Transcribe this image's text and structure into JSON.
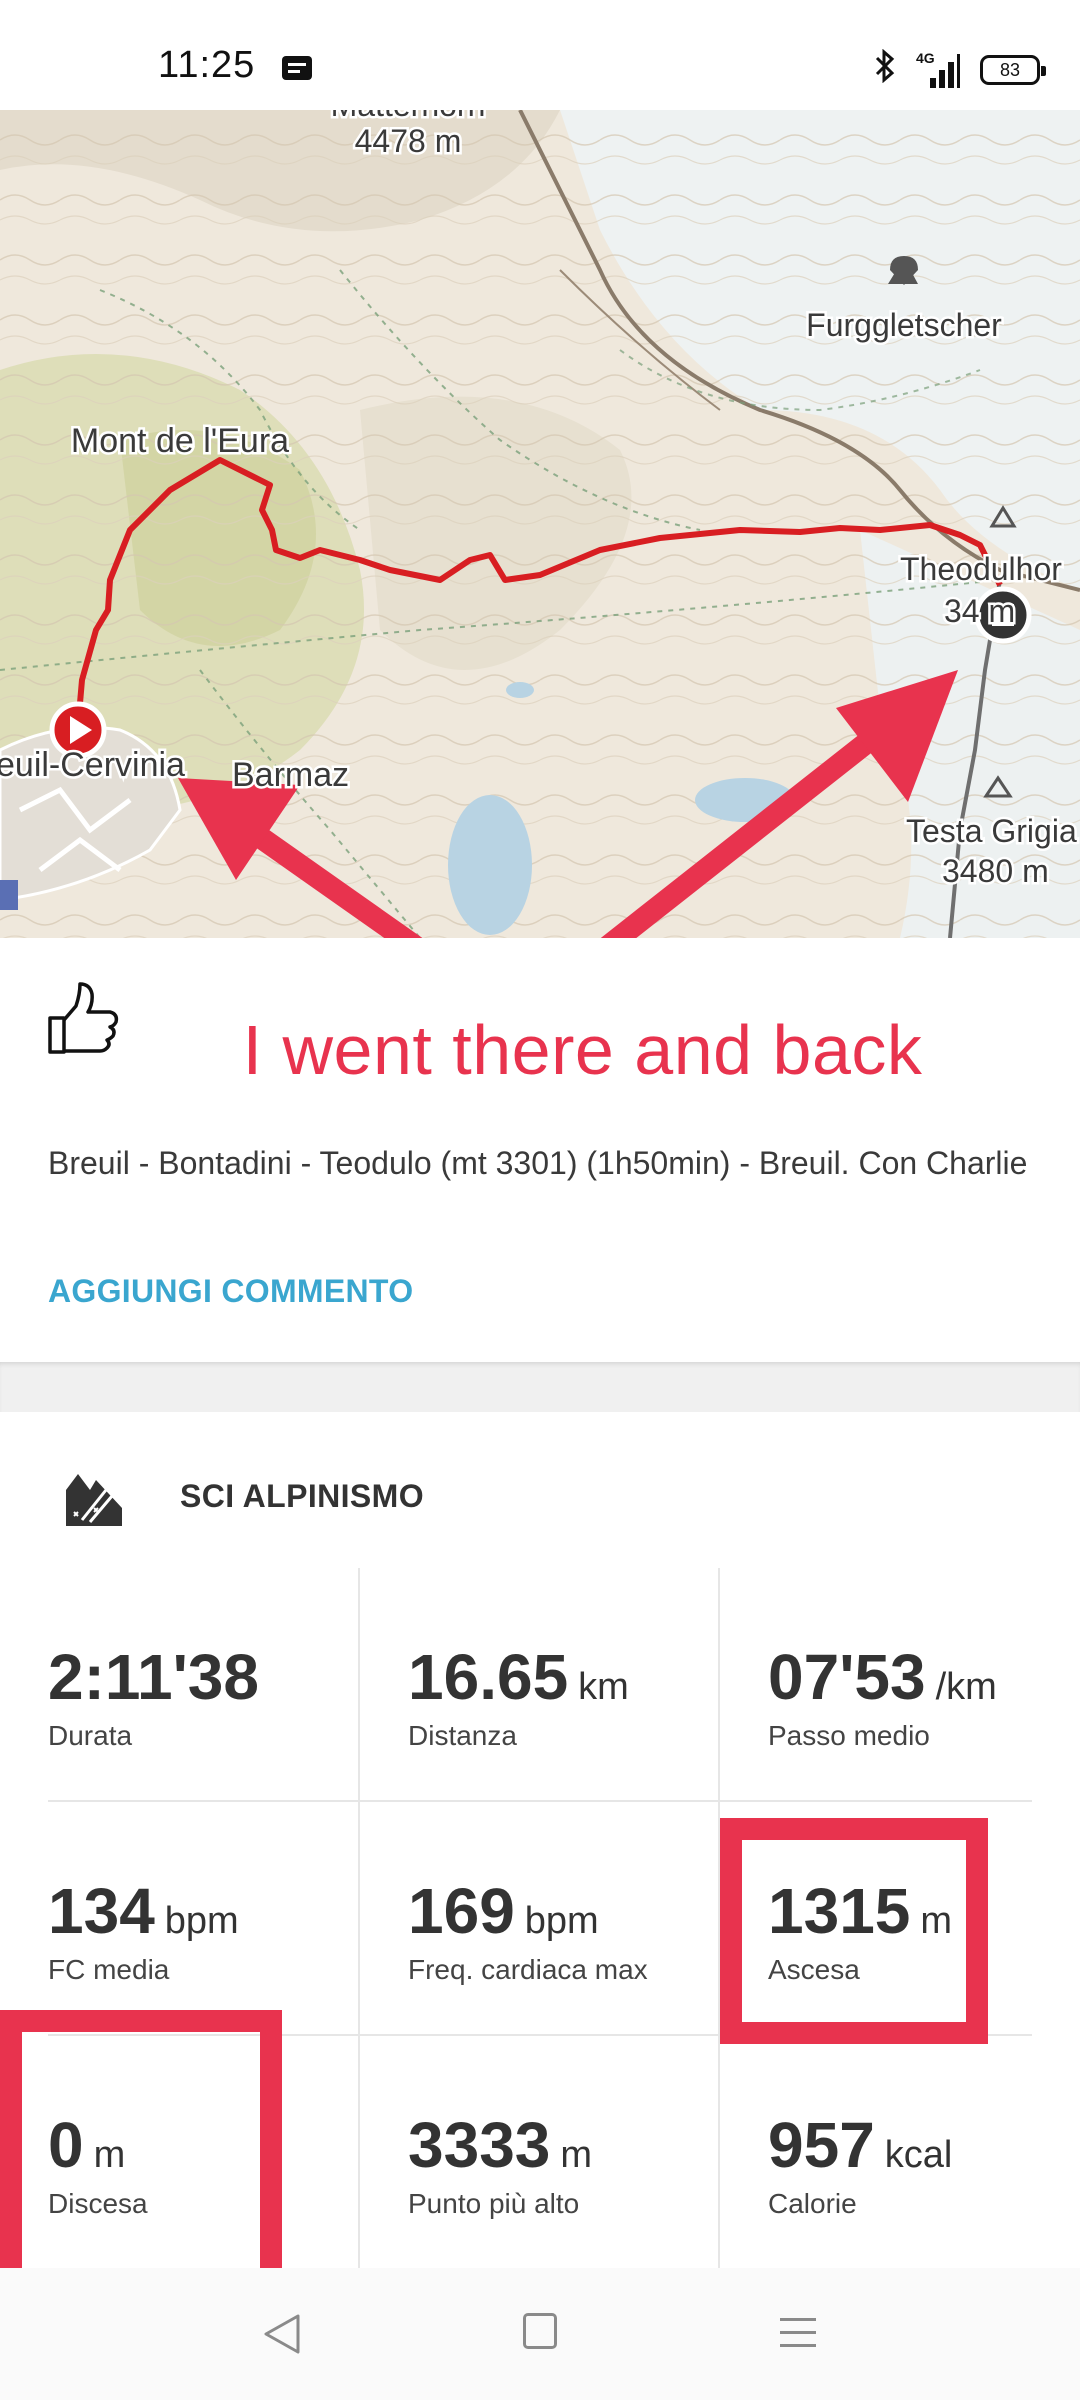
{
  "status_bar": {
    "time": "11:25",
    "network": "4G",
    "battery": "83",
    "icons": [
      "message-icon",
      "bluetooth-icon",
      "signal-icon",
      "battery-icon"
    ]
  },
  "map": {
    "labels": {
      "matterhorn_name": "Matterhorn",
      "matterhorn_elev": "4478 m",
      "furggletscher": "Furggletscher",
      "mont_eura": "Mont de l'Eura",
      "theodulhorn_name": "Theodulhor",
      "theodulhorn_elev": "34  m",
      "cervinia": "euil-Cervinia",
      "barmaz": "Barmaz",
      "testa_grigia_name": "Testa Grigia",
      "testa_grigia_elev": "3480 m"
    },
    "route_color": "#d81e22",
    "arrow_color": "#e8334e"
  },
  "annotation": {
    "text": "I went there and back",
    "color": "#e8334e"
  },
  "post": {
    "description": "Breuil - Bontadini - Teodulo (mt 3301) (1h50min) - Breuil. Con Charlie",
    "add_comment": "AGGIUNGI COMMENTO"
  },
  "activity": {
    "sport": "SCI ALPINISMO",
    "stats": [
      {
        "value": "2:11'38",
        "unit": "",
        "label": "Durata"
      },
      {
        "value": "16.65",
        "unit": "km",
        "label": "Distanza"
      },
      {
        "value": "07'53",
        "unit": "/km",
        "label": "Passo medio"
      },
      {
        "value": "134",
        "unit": "bpm",
        "label": "FC media"
      },
      {
        "value": "169",
        "unit": "bpm",
        "label": "Freq. cardiaca max"
      },
      {
        "value": "1315",
        "unit": "m",
        "label": "Ascesa"
      },
      {
        "value": "0",
        "unit": "m",
        "label": "Discesa"
      },
      {
        "value": "3333",
        "unit": "m",
        "label": "Punto più alto"
      },
      {
        "value": "957",
        "unit": "kcal",
        "label": "Calorie"
      }
    ]
  },
  "nav": {
    "icons": [
      "back-icon",
      "home-icon",
      "menu-icon"
    ]
  }
}
